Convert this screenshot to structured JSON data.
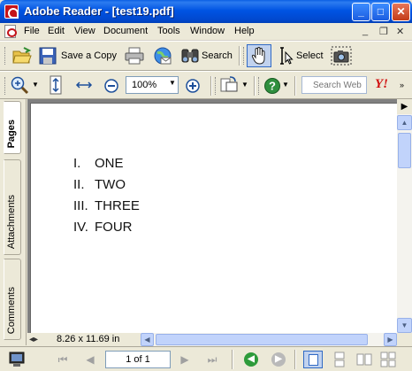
{
  "window": {
    "title": "Adobe Reader - [test19.pdf]",
    "controls": {
      "minimize": "_",
      "maximize": "□",
      "close": "✕"
    }
  },
  "menu": {
    "items": [
      "File",
      "Edit",
      "View",
      "Document",
      "Tools",
      "Window",
      "Help"
    ],
    "mdi": {
      "minimize": "_",
      "restore": "❐",
      "close": "✕"
    }
  },
  "toolbar1": {
    "save_copy_label": "Save a Copy",
    "search_label": "Search",
    "select_label": "Select"
  },
  "toolbar2": {
    "zoom_value": "100%",
    "search_web_placeholder": "Search Web",
    "yahoo_label": "Y!"
  },
  "sidetabs": [
    "Pages",
    "Attachments",
    "Comments"
  ],
  "document": {
    "lines": [
      {
        "num": "I.",
        "text": "ONE"
      },
      {
        "num": "II.",
        "text": "TWO"
      },
      {
        "num": "III.",
        "text": "THREE"
      },
      {
        "num": "IV.",
        "text": "FOUR"
      }
    ]
  },
  "status": {
    "page_size": "8.26 x 11.69 in"
  },
  "navigation": {
    "page_of": "1 of 1"
  },
  "colors": {
    "titlebar": "#0054e3",
    "chrome": "#ece9d8",
    "accent_red": "#c4141a",
    "nav_green": "#2e9b3b"
  }
}
